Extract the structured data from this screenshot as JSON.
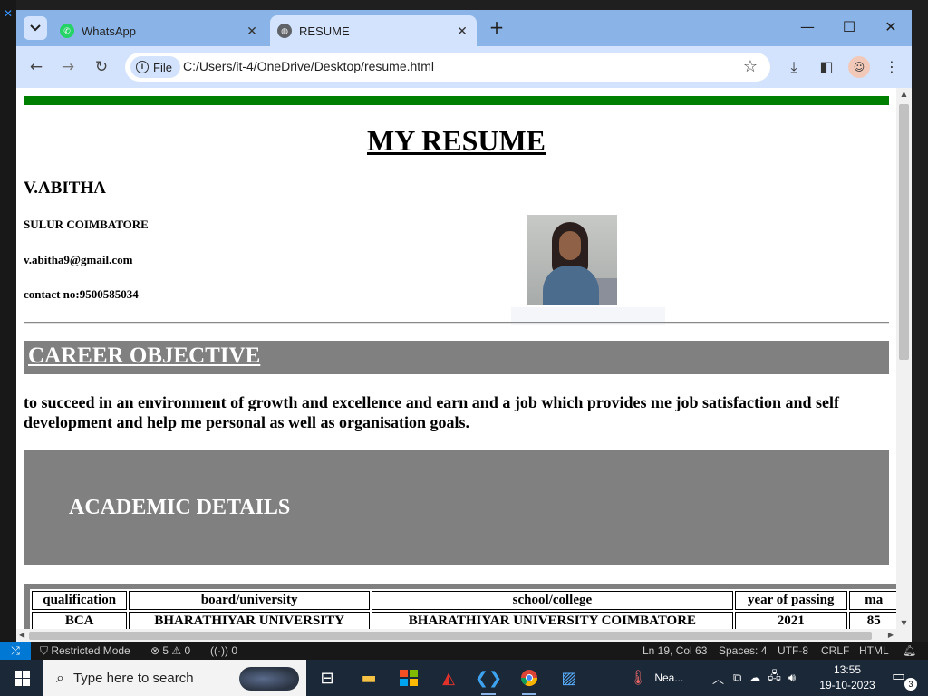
{
  "browser": {
    "tabs": [
      {
        "label": "WhatsApp",
        "active": false
      },
      {
        "label": "RESUME",
        "active": true
      }
    ],
    "address": {
      "chip": "File",
      "url": "C:/Users/it-4/OneDrive/Desktop/resume.html"
    },
    "icons": [
      "tab-search-icon",
      "whatsapp-icon",
      "globe-icon",
      "close-icon",
      "plus-icon",
      "minimize-icon",
      "maximize-icon",
      "back-icon",
      "forward-icon",
      "reload-icon",
      "info-icon",
      "star-icon",
      "download-icon",
      "side-panel-icon",
      "profile-icon",
      "more-icon"
    ]
  },
  "page": {
    "title": "MY RESUME",
    "name": "V.ABITHA",
    "location": "SULUR COIMBATORE",
    "email": "v.abitha9@gmail.com",
    "contact": "contact no:9500585034",
    "career_heading": "CAREER OBJECTIVE",
    "career_text": "to succeed in an environment of growth and excellence and earn and a job which provides me job satisfaction and self development and help me personal as well as organisation goals.",
    "academic_heading": "ACADEMIC DETAILS",
    "table": {
      "headers": [
        "qualification",
        "board/university",
        "school/college",
        "year of passing",
        "ma"
      ],
      "rows": [
        [
          "BCA",
          "BHARATHIYAR UNIVERSITY",
          "BHARATHIYAR UNIVERSITY COIMBATORE",
          "2021",
          "85"
        ]
      ]
    },
    "colors": {
      "green_bar": "#008000",
      "section_bg": "#808080"
    }
  },
  "statusbar": {
    "restricted": "Restricted Mode",
    "errors": "5",
    "warnings": "0",
    "ports": "0",
    "position": "Ln 19, Col 63",
    "spaces": "Spaces: 4",
    "encoding": "UTF-8",
    "eol": "CRLF",
    "language": "HTML"
  },
  "taskbar": {
    "search_placeholder": "Type here to search",
    "weather": "Nea...",
    "time": "13:55",
    "date": "19-10-2023",
    "notifications": "3"
  }
}
